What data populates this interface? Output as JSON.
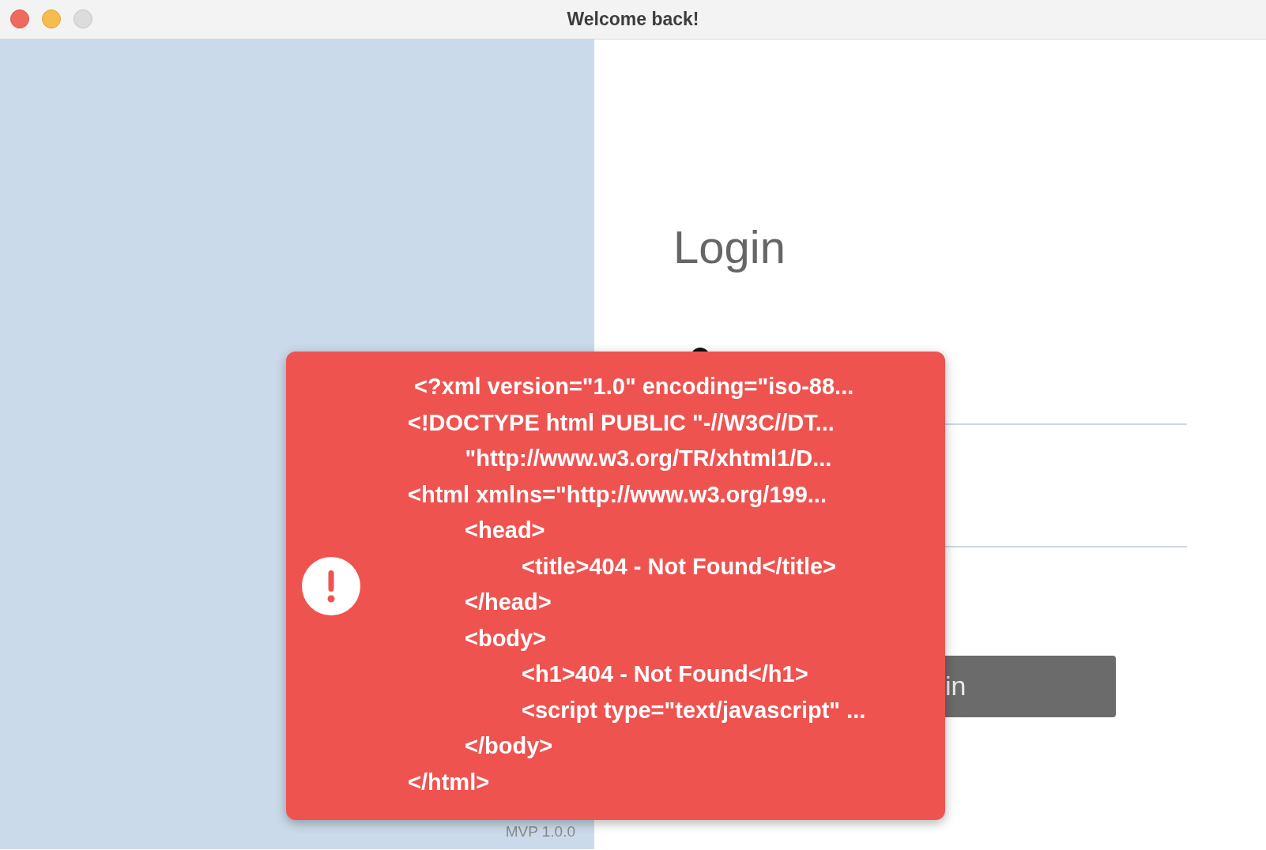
{
  "window": {
    "title": "Welcome back!"
  },
  "brand_panel": {
    "version": "MVP 1.0.0"
  },
  "login_panel": {
    "heading": "Login",
    "button": {
      "label": "in"
    }
  },
  "toast": {
    "kind": "error",
    "message": " <?xml version=\"1.0\" encoding=\"iso-88...\n<!DOCTYPE html PUBLIC \"-//W3C//DT...\n         \"http://www.w3.org/TR/xhtml1/D...\n<html xmlns=\"http://www.w3.org/199...\n\t<head>\n\t\t<title>404 - Not Found</title>\n\t</head>\n\t<body>\n\t\t<h1>404 - Not Found</h1>\n\t\t<script type=\"text/javascript\" ...\n\t</body>\n</html>"
  }
}
